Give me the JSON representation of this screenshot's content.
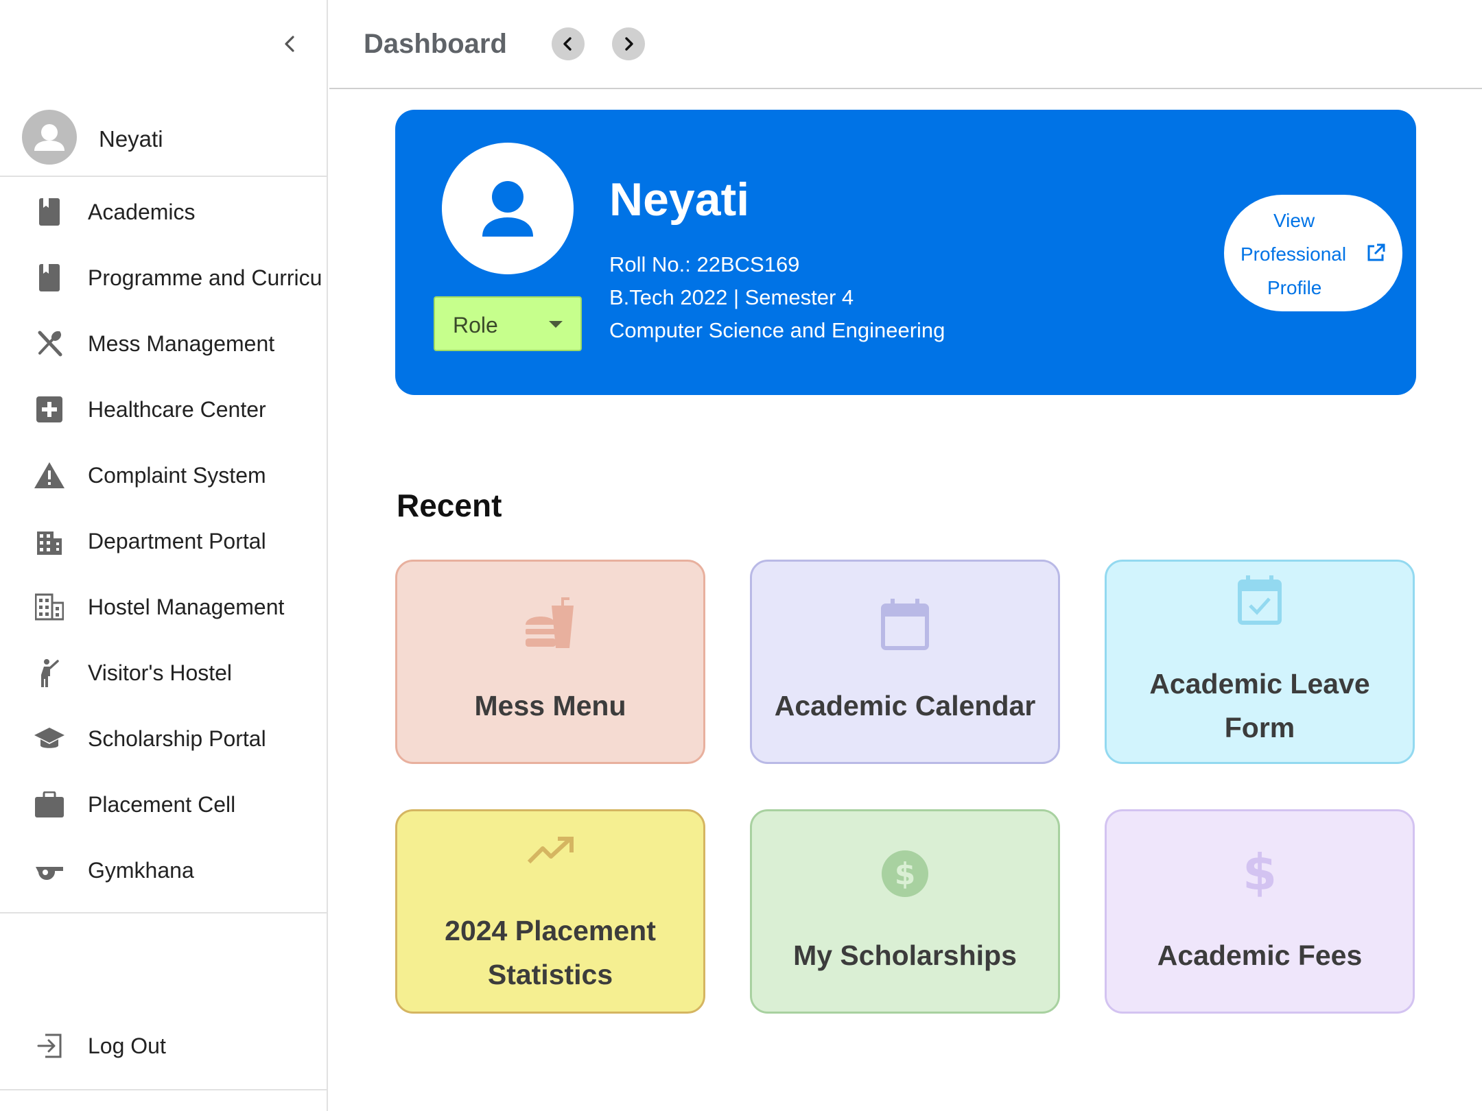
{
  "sidebar": {
    "user": {
      "name": "Neyati"
    },
    "items": [
      {
        "label": "Academics",
        "icon": "book-icon"
      },
      {
        "label": "Programme and Curricu",
        "icon": "book-icon"
      },
      {
        "label": "Mess Management",
        "icon": "utensils-icon"
      },
      {
        "label": "Healthcare Center",
        "icon": "medical-plus-icon"
      },
      {
        "label": "Complaint System",
        "icon": "warning-icon"
      },
      {
        "label": "Department Portal",
        "icon": "building-icon"
      },
      {
        "label": "Hostel Management",
        "icon": "hostel-icon"
      },
      {
        "label": "Visitor's Hostel",
        "icon": "person-waving-icon"
      },
      {
        "label": "Scholarship Portal",
        "icon": "graduation-cap-icon"
      },
      {
        "label": "Placement Cell",
        "icon": "briefcase-icon"
      },
      {
        "label": "Gymkhana",
        "icon": "whistle-icon"
      }
    ],
    "logout": {
      "label": "Log Out",
      "icon": "logout-icon"
    }
  },
  "header": {
    "title": "Dashboard"
  },
  "profile": {
    "name": "Neyati",
    "roll": "Roll No.: 22BCS169",
    "programme": "B.Tech 2022 | Semester 4",
    "department": "Computer Science and Engineering",
    "role_label": "Role",
    "view_profile": {
      "line1": "View",
      "line2": "Professional",
      "line3": "Profile"
    },
    "card_color": "#0073e6"
  },
  "recent": {
    "title": "Recent",
    "tiles": [
      {
        "label": "Mess Menu",
        "icon": "burger-soda-icon",
        "bg": "#f5dbd2",
        "border": "#e8b09e"
      },
      {
        "label": "Academic Calendar",
        "icon": "calendar-icon",
        "bg": "#e6e6fa",
        "border": "#b9b9e6"
      },
      {
        "label": "Academic Leave Form",
        "icon": "calendar-check-icon",
        "bg": "#d2f4fd",
        "border": "#93d9f0"
      },
      {
        "label": "2024 Placement Statistics",
        "icon": "trending-up-icon",
        "bg": "#f5ef91",
        "border": "#d5b561"
      },
      {
        "label": "My Scholarships",
        "icon": "dollar-circle-icon",
        "bg": "#daefd4",
        "border": "#a8d1a0"
      },
      {
        "label": "Academic Fees",
        "icon": "dollar-icon",
        "bg": "#efe6fb",
        "border": "#d3c3f1"
      }
    ]
  }
}
